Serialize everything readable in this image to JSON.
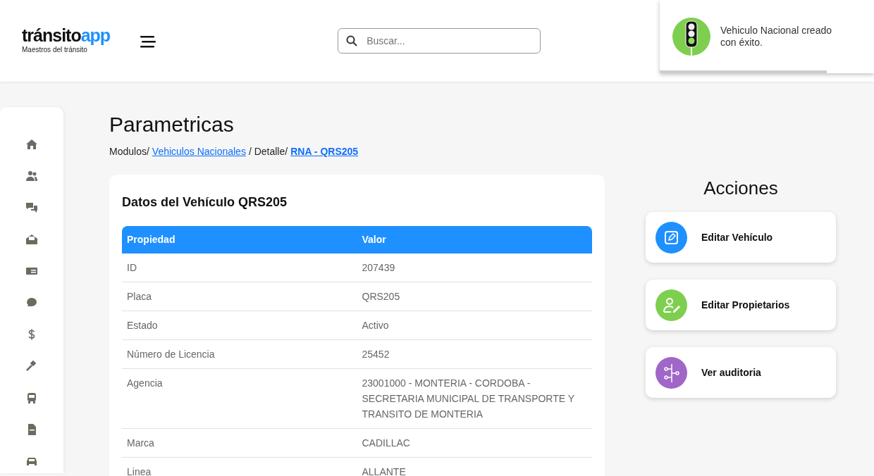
{
  "header": {
    "logo_main": "tránsito",
    "logo_accent": "app",
    "logo_tagline": "Maestros del tránsito",
    "search": {
      "placeholder": "Buscar..."
    }
  },
  "toast": {
    "message": "Vehiculo Nacional creado con éxito.",
    "level": 0.78
  },
  "page_title": "Parametricas",
  "breadcrumb": [
    {
      "label": "Modulos/",
      "kind": "text"
    },
    {
      "label": "Vehiculos Nacionales",
      "kind": "link"
    },
    {
      "label": "/ Detalle/",
      "kind": "text"
    },
    {
      "label": "RNA - QRS205",
      "kind": "current"
    }
  ],
  "card": {
    "title": "Datos del Vehículo QRS205",
    "table": {
      "columns": [
        "Propiedad",
        "Valor"
      ],
      "rows": [
        [
          "ID",
          "207439"
        ],
        [
          "Placa",
          "QRS205"
        ],
        [
          "Estado",
          "Activo"
        ],
        [
          "Número de Licencia",
          "25452"
        ],
        [
          "Agencia",
          "23001000 - MONTERIA - CORDOBA - SECRETARIA MUNICIPAL DE TRANSPORTE Y TRANSITO DE MONTERIA"
        ],
        [
          "Marca",
          "CADILLAC"
        ],
        [
          "Linea",
          "ALLANTE"
        ]
      ]
    }
  },
  "actions": {
    "title": "Acciones",
    "items": [
      {
        "label": "Editar Vehículo",
        "color": "#1e90ff"
      },
      {
        "label": "Editar Propietarios",
        "color": "#7ecf4f"
      },
      {
        "label": "Ver auditoria",
        "color": "#a066c8"
      }
    ]
  }
}
